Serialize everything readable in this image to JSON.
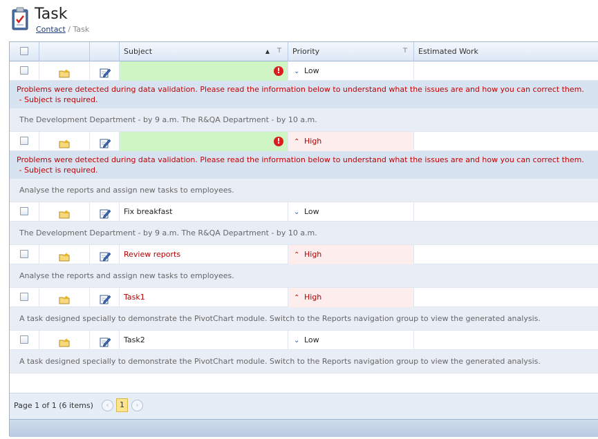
{
  "page": {
    "title": "Task",
    "breadcrumb": {
      "link": "Contact",
      "separator": "/",
      "current": "Task"
    }
  },
  "grid": {
    "columns": {
      "subject": "Subject",
      "priority": "Priority",
      "estimated_work": "Estimated Work"
    },
    "rows": [
      {
        "subject": "",
        "priority": "Low",
        "priority_level": "low",
        "invalid": true,
        "error": "Problems were detected during data validation. Please read the information below to understand what the issues are and how you can correct them.",
        "error_detail": " - Subject is required.",
        "description": "The Development Department - by 9 a.m. The R&QA Department - by 10 a.m."
      },
      {
        "subject": "",
        "priority": "High",
        "priority_level": "high",
        "invalid": true,
        "error": "Problems were detected during data validation. Please read the information below to understand what the issues are and how you can correct them.",
        "error_detail": " - Subject is required.",
        "description": "Analyse the reports and assign new tasks to employees."
      },
      {
        "subject": "Fix breakfast",
        "priority": "Low",
        "priority_level": "low",
        "description": "The Development Department - by 9 a.m. The R&QA Department - by 10 a.m."
      },
      {
        "subject": "Review reports",
        "priority": "High",
        "priority_level": "high",
        "description": "Analyse the reports and assign new tasks to employees."
      },
      {
        "subject": "Task1",
        "priority": "High",
        "priority_level": "high",
        "description": "A task designed specially to demonstrate the PivotChart module. Switch to the Reports navigation group to view the generated analysis."
      },
      {
        "subject": "Task2",
        "priority": "Low",
        "priority_level": "low",
        "description": "A task designed specially to demonstrate the PivotChart module. Switch to the Reports navigation group to view the generated analysis."
      }
    ]
  },
  "pager": {
    "info": "Page 1 of 1 (6 items)",
    "current_page": "1",
    "prev": "‹",
    "next": "›"
  },
  "icons": {
    "error": "!",
    "priority_low": "⌄",
    "priority_high": "⌃"
  },
  "colors": {
    "error_text": "#c00000",
    "invalid_bg": "#cff5c4",
    "high_bg": "#fdeeed",
    "accent": "#9db4d2"
  }
}
